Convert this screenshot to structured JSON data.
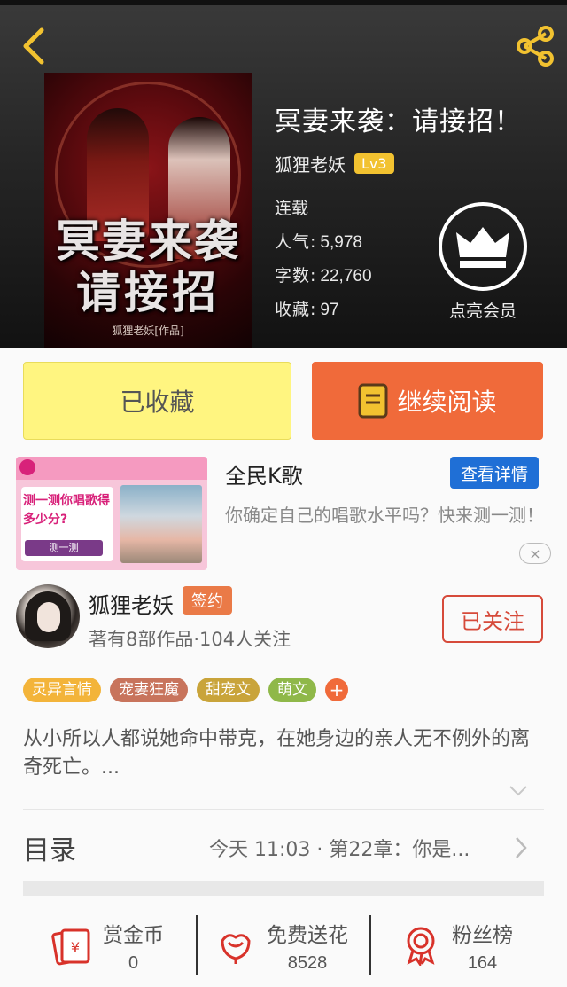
{
  "header": {
    "cover": {
      "title_line1": "冥妻来袭",
      "title_line2": "请接招",
      "credit": "狐狸老妖[作品]"
    },
    "book_title": "冥妻来袭：请接招！",
    "author": "狐狸老妖",
    "level": "Lv3",
    "status": "连载",
    "stats": [
      {
        "label": "人气:",
        "value": "5,978"
      },
      {
        "label": "字数:",
        "value": "22,760"
      },
      {
        "label": "收藏:",
        "value": "97"
      }
    ],
    "vip_label": "点亮会员",
    "icons": {
      "back": "back-arrow-icon",
      "share": "share-icon",
      "vip": "crown-icon"
    },
    "accent": "#f2c230"
  },
  "actions": {
    "collected_label": "已收藏",
    "continue_label": "继续阅读",
    "collected_color": "#fff580",
    "continue_color": "#f06a3a"
  },
  "ad": {
    "image_text": "测一测你唱歌得多少分?",
    "image_button": "测一测",
    "title": "全民K歌",
    "detail_button": "查看详情",
    "description": "你确定自己的唱歌水平吗？快来测一测！",
    "close": "×"
  },
  "author_info": {
    "name": "狐狸老妖",
    "badge": "签约",
    "stats": "著有8部作品·104人关注",
    "follow_label": "已关注"
  },
  "tags": [
    {
      "label": "灵异言情",
      "color": "#f3b43a"
    },
    {
      "label": "宠妻狂魔",
      "color": "#c8745c"
    },
    {
      "label": "甜宠文",
      "color": "#c9a43a"
    },
    {
      "label": "萌文",
      "color": "#8fb849"
    }
  ],
  "tag_more": "+",
  "synopsis": "从小所以人都说她命中带克，在她身边的亲人无不例外的离奇死亡。...",
  "toc": {
    "label": "目录",
    "latest": "今天 11:03 · 第22章：你是..."
  },
  "bottom": [
    {
      "label": "赏金币",
      "value": "0",
      "icon": "red-envelope-icon"
    },
    {
      "label": "免费送花",
      "value": "8528",
      "icon": "flower-icon"
    },
    {
      "label": "粉丝榜",
      "value": "164",
      "icon": "award-ribbon-icon"
    }
  ]
}
